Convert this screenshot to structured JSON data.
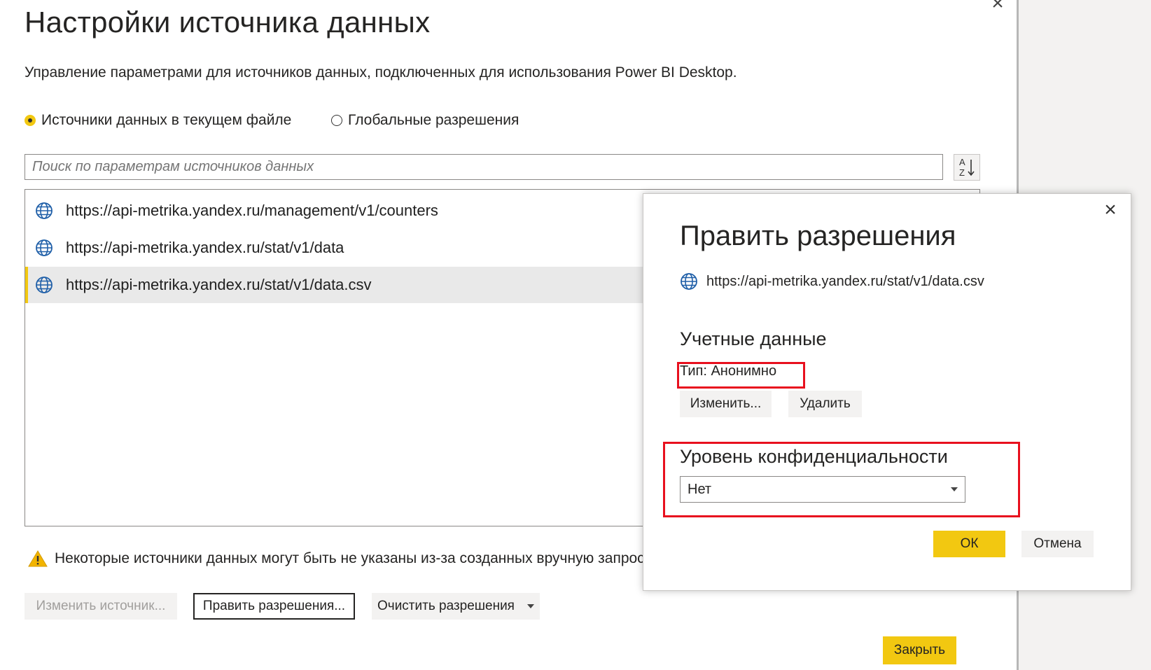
{
  "window": {
    "title": "Настройки источника данных",
    "subtitle": "Управление параметрами для источников данных, подключенных для использования Power BI Desktop.",
    "close_icon": "close-icon"
  },
  "scope": {
    "options": [
      {
        "label": "Источники данных в текущем файле",
        "selected": true
      },
      {
        "label": "Глобальные разрешения",
        "selected": false
      }
    ]
  },
  "search": {
    "placeholder": "Поиск по параметрам источников данных"
  },
  "sort_icon": "sort-az-icon",
  "sources": [
    {
      "url": "https://api-metrika.yandex.ru/management/v1/counters",
      "icon": "globe-icon",
      "selected": false
    },
    {
      "url": "https://api-metrika.yandex.ru/stat/v1/data",
      "icon": "globe-icon",
      "selected": false
    },
    {
      "url": "https://api-metrika.yandex.ru/stat/v1/data.csv",
      "icon": "globe-icon",
      "selected": true
    }
  ],
  "warning": {
    "icon": "warning-icon",
    "text": "Некоторые источники данных могут быть не указаны из-за созданных вручную запрос"
  },
  "footer": {
    "change_source": "Изменить источник...",
    "edit_permissions": "Править разрешения...",
    "clear_permissions": "Очистить разрешения",
    "close": "Закрыть"
  },
  "dialog": {
    "title": "Править разрешения",
    "url": "https://api-metrika.yandex.ru/stat/v1/data.csv",
    "credentials_heading": "Учетные данные",
    "credential_type": "Тип: Анонимно",
    "edit_button": "Изменить...",
    "delete_button": "Удалить",
    "privacy_heading": "Уровень конфиденциальности",
    "privacy_value": "Нет",
    "ok_button": "ОК",
    "cancel_button": "Отмена"
  },
  "colors": {
    "accent": "#f2c811",
    "highlight": "#e8101e",
    "selected_row": "#e9e9e9"
  }
}
